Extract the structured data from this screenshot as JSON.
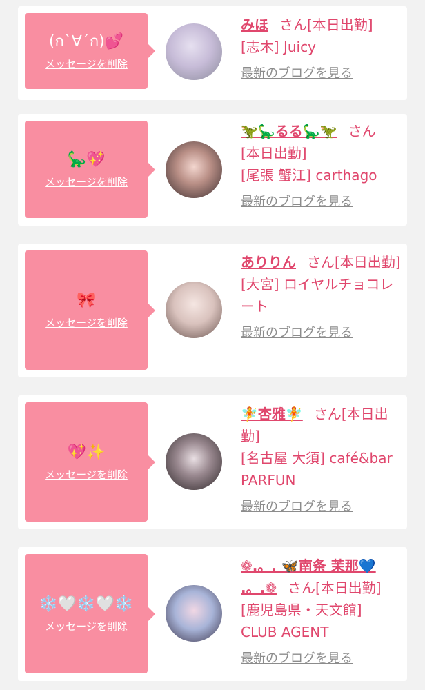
{
  "delete_label": "メッセージを削除",
  "blog_label": "最新のブログを見る",
  "san_suffix": "さん",
  "colors": {
    "accent": "#e0476d",
    "bubble": "#f98ea1",
    "muted": "#8c8c8c"
  },
  "cards": [
    {
      "message": "(ก`∀´ก)💕",
      "name": "みほ",
      "status": "[本日出勤]",
      "shop": "[志木] Juicy"
    },
    {
      "message": "🦕💖",
      "name": "🦖🦕るる🦕🦖",
      "status": "[本日出勤]",
      "shop": "[尾張 蟹江] carthago"
    },
    {
      "message": "🎀",
      "name": "ありりん",
      "status": "[本日出勤]",
      "shop": "[大宮] ロイヤルチョコレート"
    },
    {
      "message": "💖✨",
      "name": "🧚杏雅🧚",
      "status": "[本日出勤]",
      "shop": "[名古屋 大須] café&bar PARFUN"
    },
    {
      "message": "❄️🤍❄️🤍❄️",
      "name": "❁.。. 🦋南条 茉那💙 .。.❁",
      "status": "[本日出勤]",
      "shop": "[鹿児島県・天文館] CLUB AGENT"
    }
  ]
}
